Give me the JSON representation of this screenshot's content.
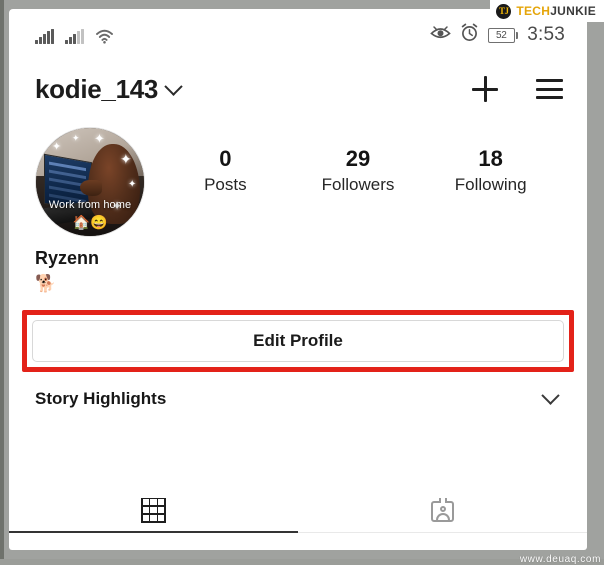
{
  "watermarks": {
    "brand_logo_text": "TJ",
    "brand_tech": "TECH",
    "brand_junkie": "JUNKIE",
    "footer_site": "www.deuaq.com"
  },
  "status_bar": {
    "signal_primary_icon": "signal-bars-icon",
    "signal_secondary_icon": "signal-bars-icon",
    "wifi_icon": "wifi-icon",
    "eye_icon": "eye-icon",
    "alarm_icon": "alarm-clock-icon",
    "battery_percent": "52",
    "time": "3:53"
  },
  "header": {
    "username": "kodie_143",
    "dropdown_icon": "chevron-down-icon",
    "add_icon": "plus-icon",
    "menu_icon": "hamburger-menu-icon"
  },
  "profile": {
    "avatar_caption": "Work from home",
    "avatar_emoji": "🏠😄",
    "avatar_alt": "dog-at-laptop-photo",
    "stats": [
      {
        "value": "0",
        "label": "Posts"
      },
      {
        "value": "29",
        "label": "Followers"
      },
      {
        "value": "18",
        "label": "Following"
      }
    ],
    "display_name": "Ryzenn",
    "bio_emoji": "🐕"
  },
  "actions": {
    "edit_profile_label": "Edit Profile",
    "annotation_color": "#e32219"
  },
  "story_highlights": {
    "title": "Story Highlights",
    "expand_icon": "chevron-down-icon"
  },
  "tabs": [
    {
      "name": "grid-tab",
      "icon": "grid-icon",
      "active": true
    },
    {
      "name": "tagged-tab",
      "icon": "tagged-photos-icon",
      "active": false
    }
  ]
}
